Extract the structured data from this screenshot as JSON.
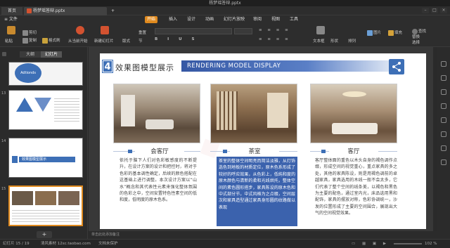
{
  "window": {
    "title": "杨梦瑶答辩.pptx"
  },
  "tabs": {
    "home": "首页",
    "file": "杨梦瑶答辩.pptx",
    "new": "+"
  },
  "menu": {
    "file": "≡ 文件",
    "start": "开始",
    "insert": "插入",
    "design": "设计",
    "animation": "动画",
    "slideshow": "幻灯片放映",
    "review": "审阅",
    "view": "视图",
    "tools": "工具"
  },
  "ribbon": {
    "paste": "粘贴",
    "cut": "剪切",
    "copy": "复制",
    "format_painter": "格式刷",
    "from_start": "从当前开始",
    "new_slide": "新建幻灯片",
    "layout": "版式",
    "section": "节",
    "reset": "重置",
    "textbox": "文本框",
    "shape": "形状",
    "arrange": "排列",
    "picture": "图片",
    "fill": "填充",
    "find": "查找",
    "replace": "替换",
    "select": "选择"
  },
  "sidebar": {
    "tab_outline": "大纲",
    "tab_slides": "幻灯片",
    "add": "+",
    "slide_nums": [
      "13",
      "14",
      "15"
    ],
    "thumb_title": "Adtionds",
    "thumb_heading": "效果图模型展示"
  },
  "slide": {
    "number": "4",
    "title": "效果图模型展示",
    "banner": "RENDERING MODEL DISPLAY",
    "captions": [
      "会客厅",
      "茶室",
      "客厅"
    ],
    "texts": [
      "依托于脑下人们对色彩敏感度的不断提升，在设计方案的设计和把控时，将对于色彩的基本调性确定，后续的颜色搭配在这基础上进行调整。本次设计方案以“山水”概念和其代表性元素来强化整体氛围的色彩之中，空间安置特色性素空间的低和度，低明度的原木色系。",
      "茶室的整体空间明亮而简洁淡雅，从灯饰选色到地板的材质定位，原木色系形成了较好的呼应效果，从色彩上，低纯和度的原木颜色与清新的柔和光线烘托，整体空间的素色圆形搭步，家具陈设的原木色和中式部分节，中式风格为之点缀，空间层次和家具造型通过家具身形圆的纹路做以表现",
      "客厅整体面的重色以木头自身的褐色调作点缀，形成空间的视觉重心，重点家具的多之处，其他的家具陈设，则是用褐色调前的卓越家具，家具选用的木线一般不会太多，它们代表了整个空间的线条美，以褐色和黑色为主要的配色，通过室内光，床品选用黑和配饰，家具的摆放对称，色彩协调统一，沙发的位置形成了主要的空间围合，展现出大气的空间视觉效果。"
    ]
  },
  "notes": "单击此处添加备注",
  "status": {
    "slide": "幻灯片 15 / 19",
    "theme": "清风素材 12sc.taobao.com",
    "protect": "文档未保护",
    "zoom": "102 %"
  },
  "colors": {
    "accent": "#3d6fb6",
    "start_tab": "#e08a1e",
    "banner_start": "#3557a4"
  }
}
